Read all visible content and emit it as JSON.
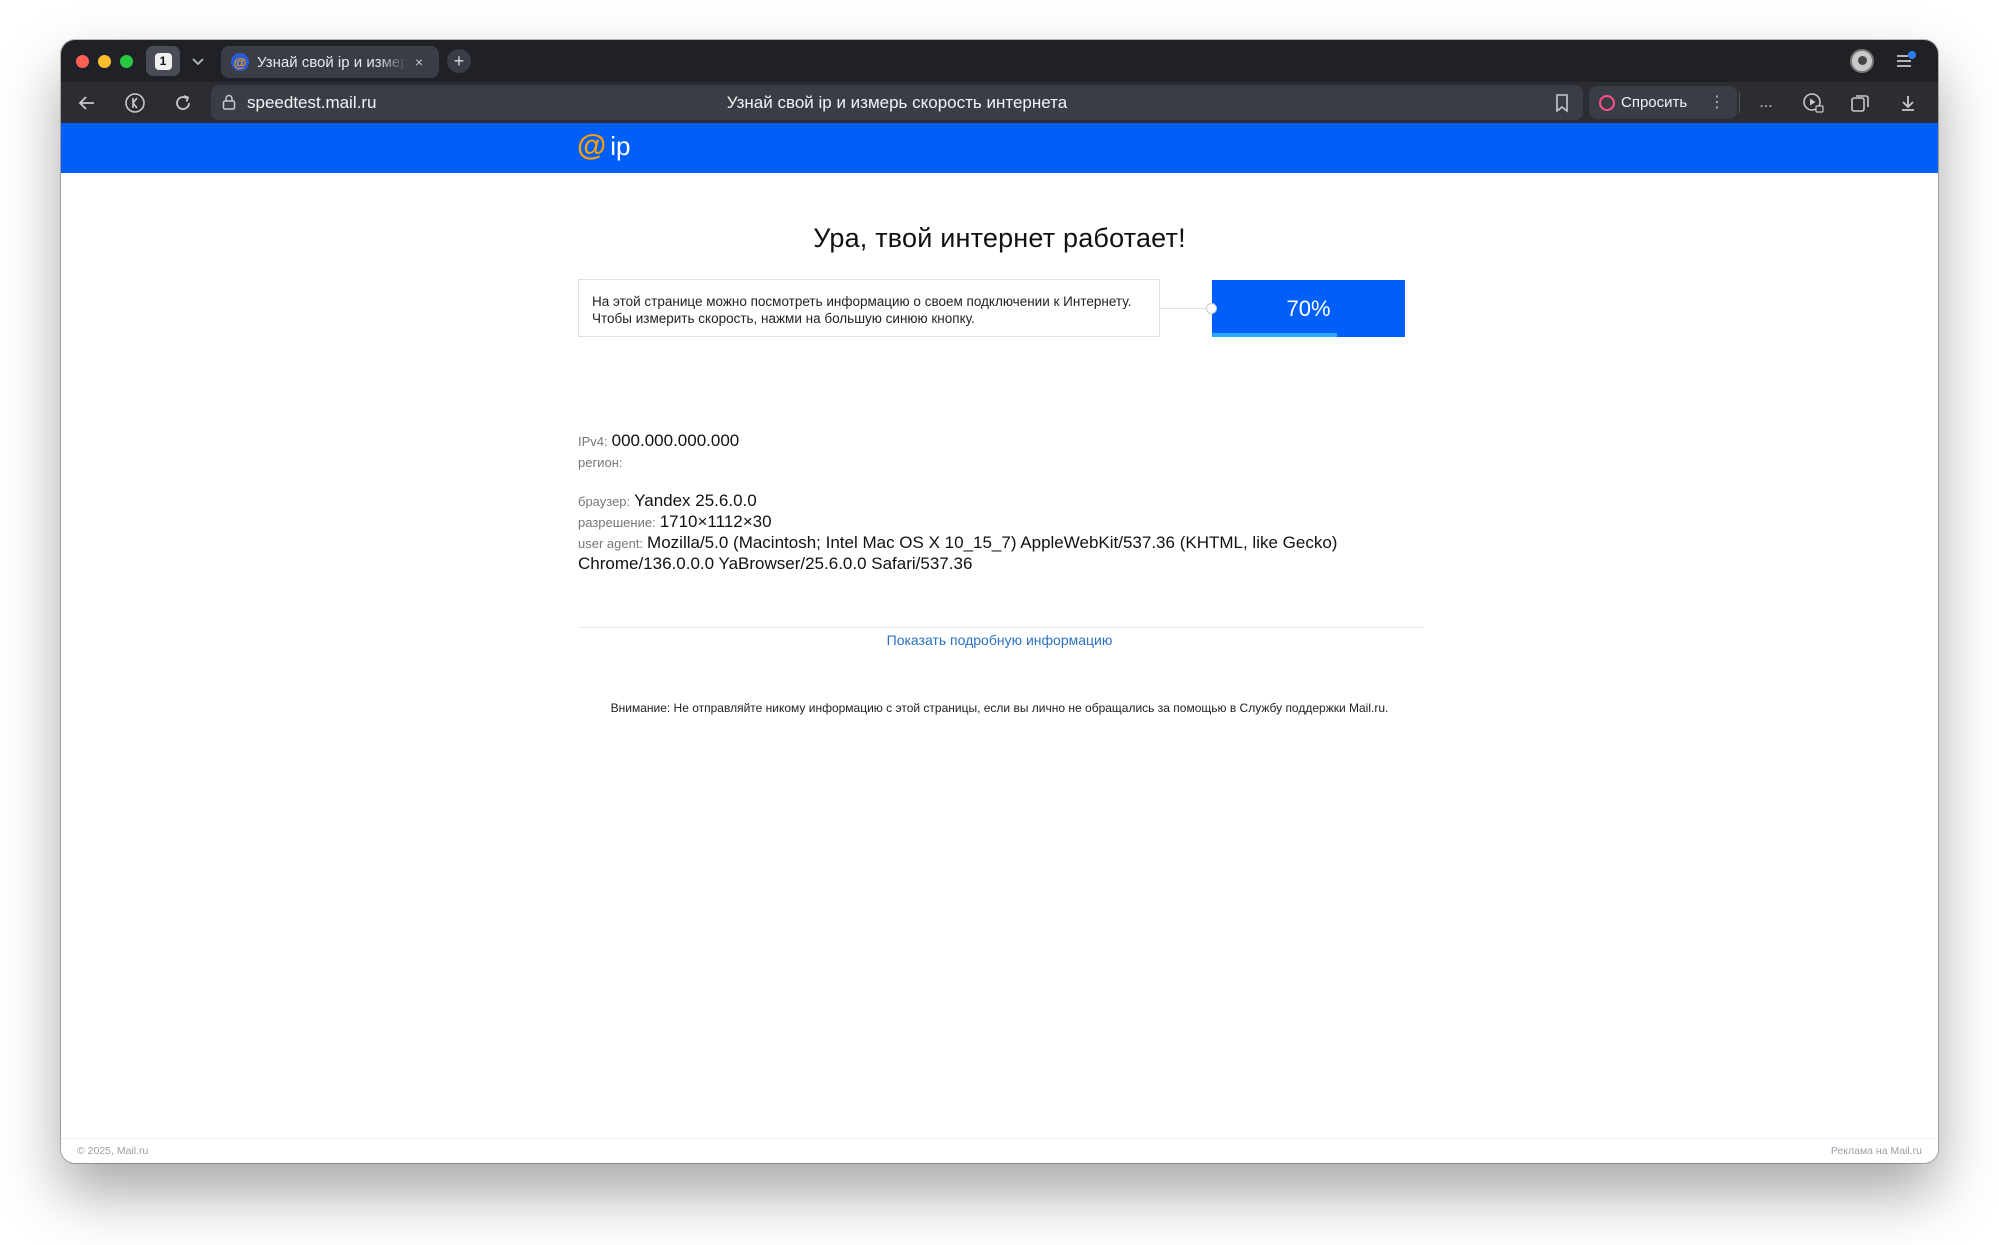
{
  "browser": {
    "tab_count": "1",
    "tab": {
      "title": "Узнай свой ip и измерь скорость интернета",
      "close": "×"
    },
    "new_tab": "+",
    "url": "speedtest.mail.ru",
    "page_title": "Узнай свой ip и измерь скорость интернета",
    "ask_label": "Спросить",
    "more_label": "...",
    "ask_menu": "⋮"
  },
  "site": {
    "logo_mark": "@",
    "logo_text": "ip",
    "headline": "Ура, твой интернет работает!",
    "intro": "На этой странице можно посмотреть информацию о своем подключении к Интернету. Чтобы измерить скорость, нажми на большую синюю кнопку.",
    "speed_button": {
      "label": "70%",
      "progress": 0.65
    },
    "info": {
      "ipv4_label": "IPv4:",
      "ipv4": "000.000.000.000",
      "region_label": "регион:",
      "region": "",
      "browser_label": "браузер:",
      "browser": "Yandex 25.6.0.0",
      "resolution_label": "разрешение:",
      "resolution": "1710×1112×30",
      "ua_label": "user agent:",
      "ua_line1": "Mozilla/5.0 (Macintosh; Intel Mac OS X 10_15_7) AppleWebKit/537.36 (KHTML, like Gecko)",
      "ua_line2": "Chrome/136.0.0.0 YaBrowser/25.6.0.0 Safari/537.36"
    },
    "more_info_link": "Показать подробную информацию",
    "warning": "Внимание: Не отправляйте никому информацию с этой страницы, если вы лично не обращались за помощью в Службу поддержки Mail.ru.",
    "footer_left": "© 2025, Mail.ru",
    "footer_right": "Реклама на Mail.ru"
  },
  "colors": {
    "brand_blue": "#005ff9",
    "logo_orange": "#ff9e00",
    "link_blue": "#2a71c5",
    "progress": "#2aa7ff"
  },
  "icons": [
    "back-arrow-icon",
    "yandex-icon",
    "reload-icon",
    "lock-icon",
    "bookmark-icon",
    "alice-icon",
    "player-icon",
    "collections-icon",
    "download-icon",
    "profile-icon",
    "menu-icon"
  ]
}
